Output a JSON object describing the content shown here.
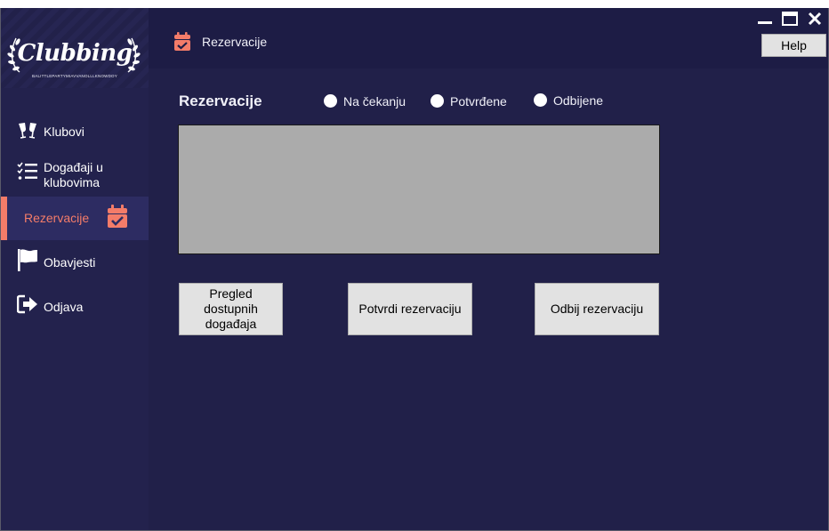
{
  "app": {
    "logo": "Clubbing",
    "logo_sub": "BALITTLEPARTYMIAVVANOLLLKNOWDOY"
  },
  "window": {
    "minimize_icon": "minimize-icon",
    "maximize_icon": "maximize-icon",
    "close_icon": "close-icon",
    "help_label": "Help"
  },
  "header": {
    "title": "Rezervacije",
    "icon": "calendar-check-icon"
  },
  "sidebar": {
    "items": [
      {
        "label": "Klubovi",
        "icon": "cheers-icon"
      },
      {
        "label": "Događaji u klubovima",
        "icon": "checklist-icon"
      },
      {
        "label": "Rezervacije",
        "icon": "calendar-check-icon",
        "active": true
      },
      {
        "label": "Obavjesti",
        "icon": "flag-icon"
      },
      {
        "label": "Odjava",
        "icon": "logout-icon"
      }
    ]
  },
  "main": {
    "title": "Rezervacije",
    "filters": [
      {
        "label": "Na čekanju",
        "checked": false
      },
      {
        "label": "Potvrđene",
        "checked": false
      },
      {
        "label": "Odbijene",
        "checked": false
      }
    ],
    "buttons": {
      "events": "Pregled dostupnih događaja",
      "confirm": "Potvrdi rezervaciju",
      "reject": "Odbij rezervaciju"
    }
  },
  "colors": {
    "background": "#212049",
    "sidebar": "#23224d",
    "header": "#1d1c45",
    "accent": "#f47c69",
    "grid": "#ababab"
  }
}
